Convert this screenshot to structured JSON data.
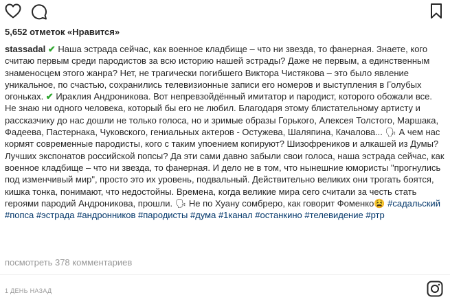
{
  "actions": {
    "like_icon": "heart-outline-icon",
    "comment_icon": "comment-bubble-icon",
    "save_icon": "bookmark-icon"
  },
  "likes_text": "5,652 отметок «Нравится»",
  "caption": {
    "username": "stassadal",
    "part1": " Наша эстрада сейчас, как военное кладбище – что ни звезда, то фанерная. Знаете, кого считаю первым среди пародистов за всю историю нашей эстрады? Даже не первым, а единственным знаменосцем этого жанра? Нет, не трагически погибшего Виктора Чистякова – это было явление уникальное, по счастью, сохранились телевизионные записи его номеров и выступления в Голубых огоньках. ",
    "part2": " Ираклия Андроникова. Вот непревзойдённый имитатор и пародист, которого обожали все. Не знаю ни одного человека, который бы его не любил. Благодаря этому блистательному артисту и рассказчику до нас дошли не только голоса, но и зримые образы Горького, Алексея Толстого, Маршака, Фадеева, Пастернака, Чуковского, гениальных актеров - Остужева, Шаляпина, Качалова... ",
    "part3": " А чем нас кормят современные пародисты, кого с таким упоением копируют? Шизофреников и алкашей из Думы? Лучших экспонатов российской попсы? Да эти сами давно забыли свои голоса, наша эстрада сейчас, как военное кладбище – что ни звезда, то фанерная. И дело не в том, что нынешние юмористы \"прогнулись под изменчивый мир\", просто это их уровень, подвальный. Действительно великих они трогать боятся, кишка тонка, понимают, что недостойны. Времена, когда великие мира сего считали за честь стать героями пародий Андроникова, прошли. ",
    "part4": " Не по Хуану сомбреро, как говорит Фоменко",
    "check_emoji": "✔",
    "speaker_emoji": "🗣",
    "face_emoji": "😫",
    "hashtags": [
      "#садальский",
      "#попса",
      "#эстрада",
      "#андронников",
      "#пародисты",
      "#дума",
      "#1канал",
      "#останкино",
      "#телевидение",
      "#ртр"
    ]
  },
  "view_comments": "посмотреть 378 комментариев",
  "timestamp": "1 день назад",
  "footer_icon": "instagram-icon",
  "colors": {
    "text": "#262626",
    "muted": "#999999",
    "hashtag": "#003569",
    "check": "#2ca52c"
  }
}
